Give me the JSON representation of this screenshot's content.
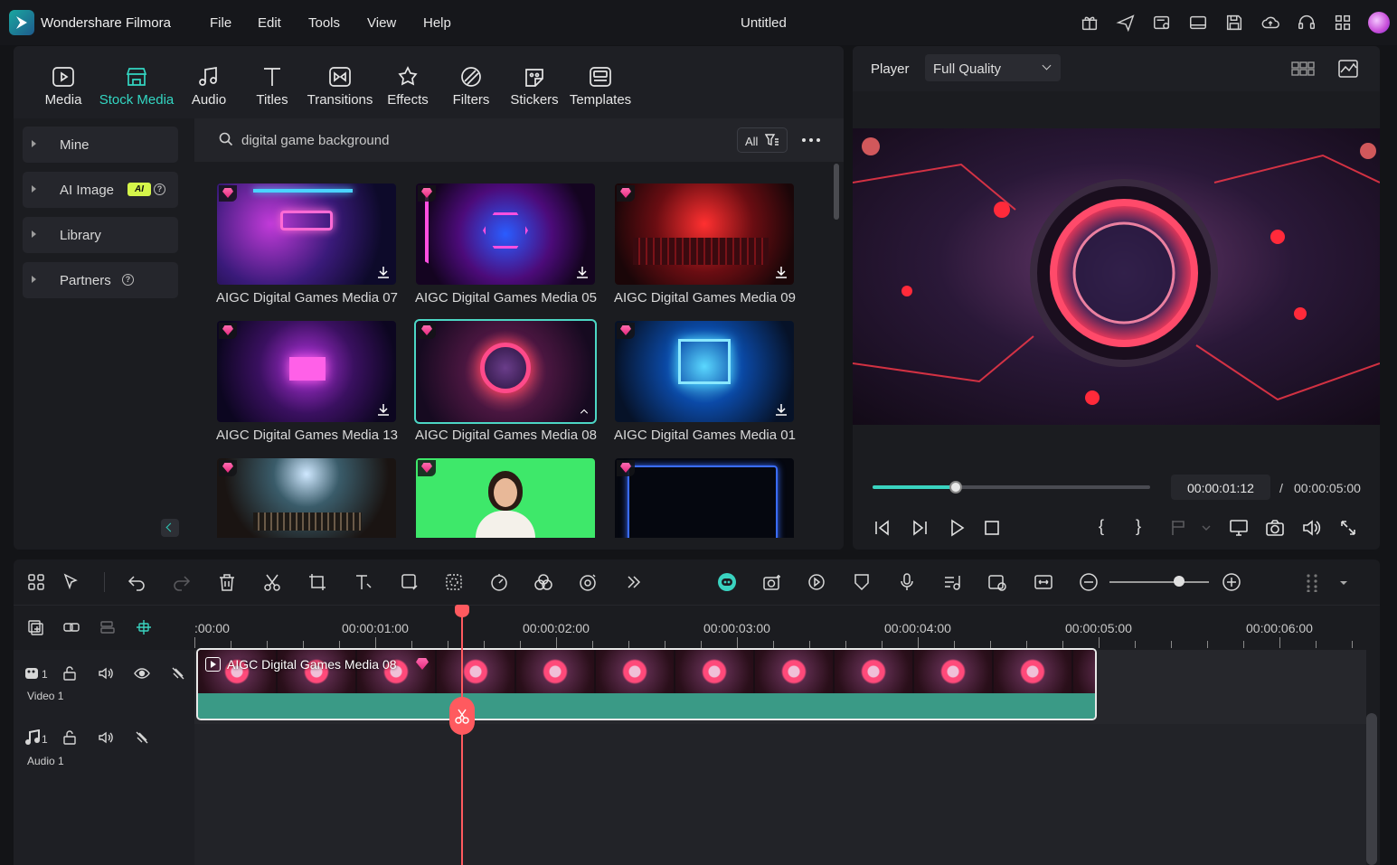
{
  "app": {
    "name": "Wondershare Filmora",
    "document_title": "Untitled"
  },
  "menu": [
    "File",
    "Edit",
    "Tools",
    "View",
    "Help"
  ],
  "toolbar_icons": [
    "gift-icon",
    "send-icon",
    "projects-icon",
    "layout-icon",
    "save-icon",
    "cloud-icon",
    "support-icon",
    "apps-icon",
    "avatar"
  ],
  "media_tabs": [
    {
      "label": "Media",
      "icon": "media-icon",
      "active": false
    },
    {
      "label": "Stock Media",
      "icon": "stock-media-icon",
      "active": true
    },
    {
      "label": "Audio",
      "icon": "audio-icon",
      "active": false
    },
    {
      "label": "Titles",
      "icon": "titles-icon",
      "active": false
    },
    {
      "label": "Transitions",
      "icon": "transitions-icon",
      "active": false
    },
    {
      "label": "Effects",
      "icon": "effects-icon",
      "active": false
    },
    {
      "label": "Filters",
      "icon": "filters-icon",
      "active": false
    },
    {
      "label": "Stickers",
      "icon": "stickers-icon",
      "active": false
    },
    {
      "label": "Templates",
      "icon": "templates-icon",
      "active": false
    }
  ],
  "side_nav": [
    {
      "label": "Mine"
    },
    {
      "label": "AI Image",
      "badge": "AI"
    },
    {
      "label": "Library"
    },
    {
      "label": "Partners"
    }
  ],
  "search": {
    "query": "digital game background",
    "filter_label": "All"
  },
  "media_items": [
    {
      "label": "AIGC Digital Games Media 07"
    },
    {
      "label": "AIGC Digital Games Media 05"
    },
    {
      "label": "AIGC Digital Games Media 09"
    },
    {
      "label": "AIGC Digital Games Media 13"
    },
    {
      "label": "AIGC Digital Games Media 08"
    },
    {
      "label": "AIGC Digital Games Media 01"
    }
  ],
  "player": {
    "label": "Player",
    "quality": "Full Quality",
    "current_time": "00:00:01:12",
    "separator": "/",
    "total_time": "00:00:05:00",
    "progress": 0.3,
    "mark_in": "{",
    "mark_out": "}"
  },
  "timeline": {
    "ruler": [
      ":00:00",
      "00:00:01:00",
      "00:00:02:00",
      "00:00:03:00",
      "00:00:04:00",
      "00:00:05:00",
      "00:00:06:00"
    ],
    "tracks": [
      {
        "number": "1",
        "name": "Video 1"
      },
      {
        "number": "1",
        "name": "Audio 1"
      }
    ],
    "clip": {
      "title": "AIGC Digital Games Media 08"
    },
    "zoom_level": 0.7
  },
  "colors": {
    "accent": "#33d6c2",
    "playhead": "#ff5a5f",
    "clip_audio": "#3a9a86",
    "background": "#131417"
  }
}
